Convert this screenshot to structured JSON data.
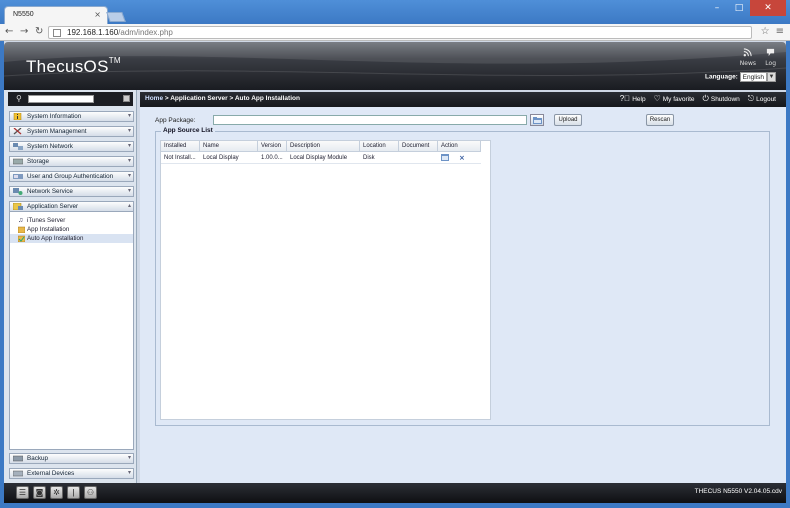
{
  "browser": {
    "tab_title": "N5550",
    "tab_close": "×",
    "url_host": "192.168.1.160",
    "url_path": "/adm/index.php",
    "back": "←",
    "forward": "→",
    "reload": "↻",
    "star": "☆",
    "menu": "≡",
    "min": "–",
    "max": "□",
    "close": "✕"
  },
  "header": {
    "logo": "ThecusOS",
    "logo_tm": "TM",
    "news_label": "News",
    "log_label": "Log",
    "language_label": "Language:",
    "language_value": "English"
  },
  "sidebar": {
    "search_placeholder": "",
    "menus": [
      {
        "label": "System Information",
        "icon": "info-icon"
      },
      {
        "label": "System Management",
        "icon": "tools-icon"
      },
      {
        "label": "System Network",
        "icon": "network-icon"
      },
      {
        "label": "Storage",
        "icon": "storage-icon"
      },
      {
        "label": "User and Group Authentication",
        "icon": "users-icon"
      },
      {
        "label": "Network Service",
        "icon": "service-icon"
      },
      {
        "label": "Application Server",
        "icon": "app-server-icon"
      }
    ],
    "sub_items": [
      {
        "label": "iTunes Server",
        "icon": "music-note-icon"
      },
      {
        "label": "App Installation",
        "icon": "package-icon"
      },
      {
        "label": "Auto App Installation",
        "icon": "auto-package-icon"
      }
    ],
    "bottom_menus": [
      {
        "label": "Backup",
        "icon": "backup-icon"
      },
      {
        "label": "External Devices",
        "icon": "external-device-icon"
      }
    ]
  },
  "breadcrumb": {
    "home": "Home",
    "path": " > Application Server > Auto App Installation",
    "help": "Help",
    "favorite": "My favorite",
    "shutdown": "Shutdown",
    "logout": "Logout"
  },
  "main": {
    "package_label": "App Package:",
    "package_value": "",
    "upload_label": "Upload",
    "rescan_label": "Rescan",
    "source_list_title": "App Source List",
    "columns": [
      "Installed",
      "Name",
      "Version",
      "Description",
      "Location",
      "Document",
      "Action"
    ],
    "rows": [
      {
        "installed": "Not Install...",
        "name": "Local Display",
        "version": "1.00.0...",
        "description": "Local Display Module",
        "location": "Disk",
        "document": ""
      }
    ]
  },
  "footer": {
    "version": "THECUS N5550 V2.04.05.cdv"
  },
  "colors": {
    "accent": "#3c79c4",
    "header_dark": "#1a1c21",
    "content_bg": "#dfe8f6"
  }
}
